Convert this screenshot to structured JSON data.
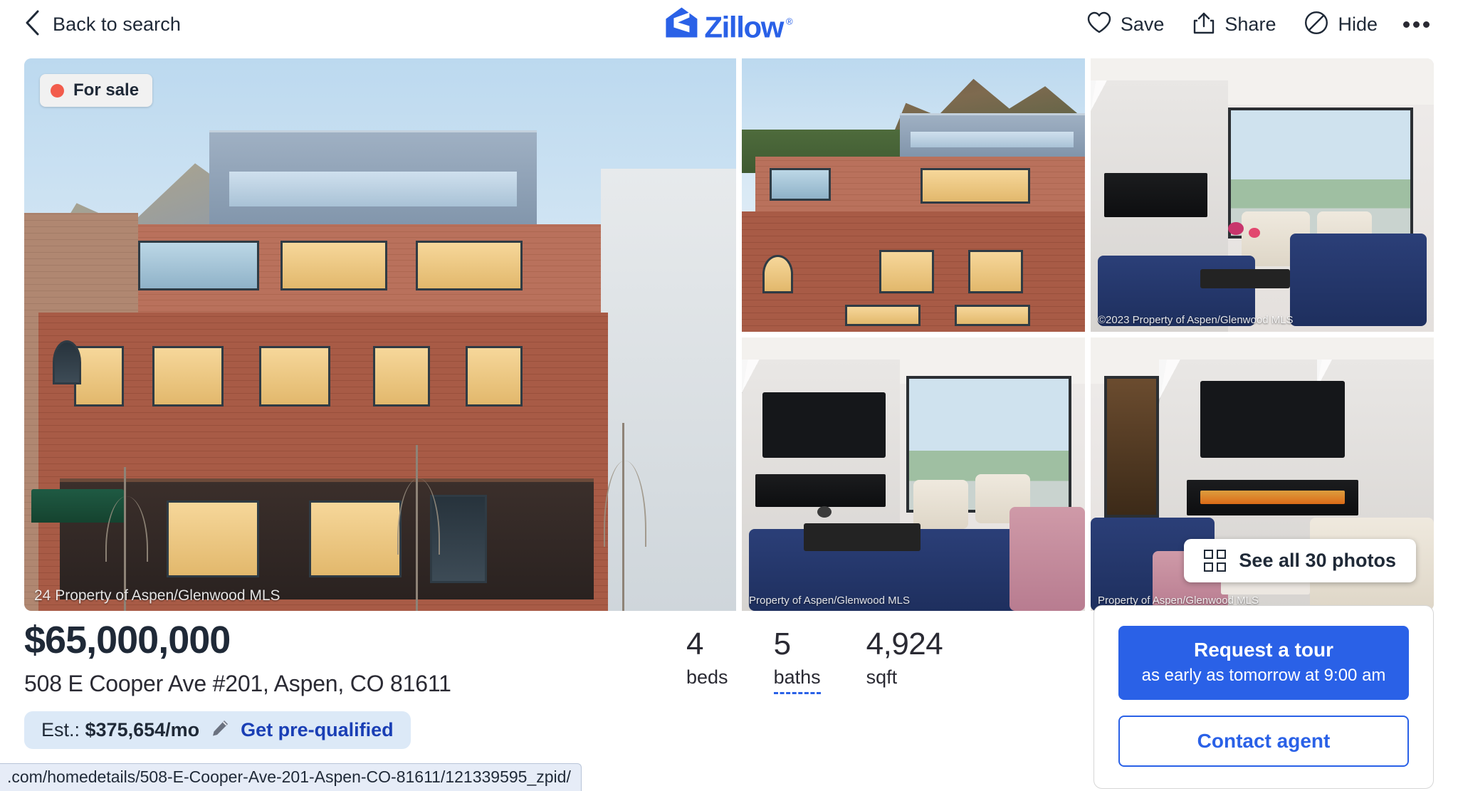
{
  "header": {
    "back_label": "Back to search",
    "back_icon": "chevron-left-icon",
    "logo_word": "Zillow",
    "logo_reg": "®",
    "actions": [
      {
        "label": "Save",
        "icon": "heart-icon"
      },
      {
        "label": "Share",
        "icon": "share-icon"
      },
      {
        "label": "Hide",
        "icon": "circle-slash-icon"
      }
    ],
    "more_icon": "more-horizontal-icon"
  },
  "gallery": {
    "status_badge": {
      "label": "For sale",
      "dot_color": "#f25c4c"
    },
    "see_all_photos": {
      "label": "See all 30 photos",
      "icon": "grid-icon",
      "count": 30
    },
    "watermarks": {
      "main": "24 Property of Aspen/Glenwood MLS",
      "top_right": "©2023 Property of Aspen/Glenwood MLS",
      "bottom_mid": "Property of Aspen/Glenwood MLS",
      "bottom_right": "Property of Aspen/Glenwood MLS"
    }
  },
  "listing": {
    "price": "$65,000,000",
    "address": "508 E Cooper Ave #201, Aspen, CO 81611",
    "estimate": {
      "prefix": "Est.: ",
      "amount": "$375,654/mo",
      "edit_icon": "pencil-icon",
      "link_label": "Get pre-qualified"
    },
    "facts": [
      {
        "value": "4",
        "label": "beds",
        "hint": false
      },
      {
        "value": "5",
        "label": "baths",
        "hint": true
      },
      {
        "value": "4,924",
        "label": "sqft",
        "hint": false
      }
    ]
  },
  "cta": {
    "request_tour": {
      "title": "Request a tour",
      "subtitle": "as early as tomorrow at 9:00 am"
    },
    "contact_agent": "Contact agent"
  },
  "status_bar": {
    "url": ".com/homedetails/508-E-Cooper-Ave-201-Aspen-CO-81611/121339595_zpid/"
  },
  "colors": {
    "brand_blue": "#2a61e7",
    "link_blue": "#1a3fb5",
    "text_dark": "#1f2937",
    "status_dot": "#f25c4c"
  }
}
